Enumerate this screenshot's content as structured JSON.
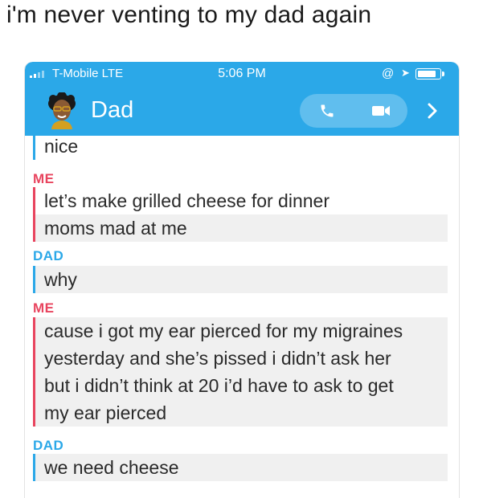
{
  "caption": "i'm never venting to my dad again",
  "status_bar": {
    "carrier": "T-Mobile  LTE",
    "time": "5:06 PM"
  },
  "header": {
    "contact_name": "Dad",
    "icons": [
      "avatar-bitmoji",
      "phone-icon",
      "video-icon",
      "chevron-right-icon"
    ],
    "accent_color": "#2ba8e8"
  },
  "colors": {
    "me": "#e8445e",
    "dad": "#2ba8e8"
  },
  "messages": [
    {
      "text": "nice"
    },
    {
      "sender": "ME",
      "text": "let’s make grilled cheese for dinner"
    },
    {
      "text": "moms mad at me"
    },
    {
      "sender": "DAD",
      "text": "why"
    },
    {
      "sender": "ME",
      "lines": [
        "cause i got my ear pierced for my migraines",
        "yesterday and she’s pissed i didn’t ask her",
        "but i didn’t think at 20 i’d have to ask to get",
        "my ear pierced"
      ]
    },
    {
      "sender": "DAD",
      "text": "we need cheese"
    }
  ]
}
